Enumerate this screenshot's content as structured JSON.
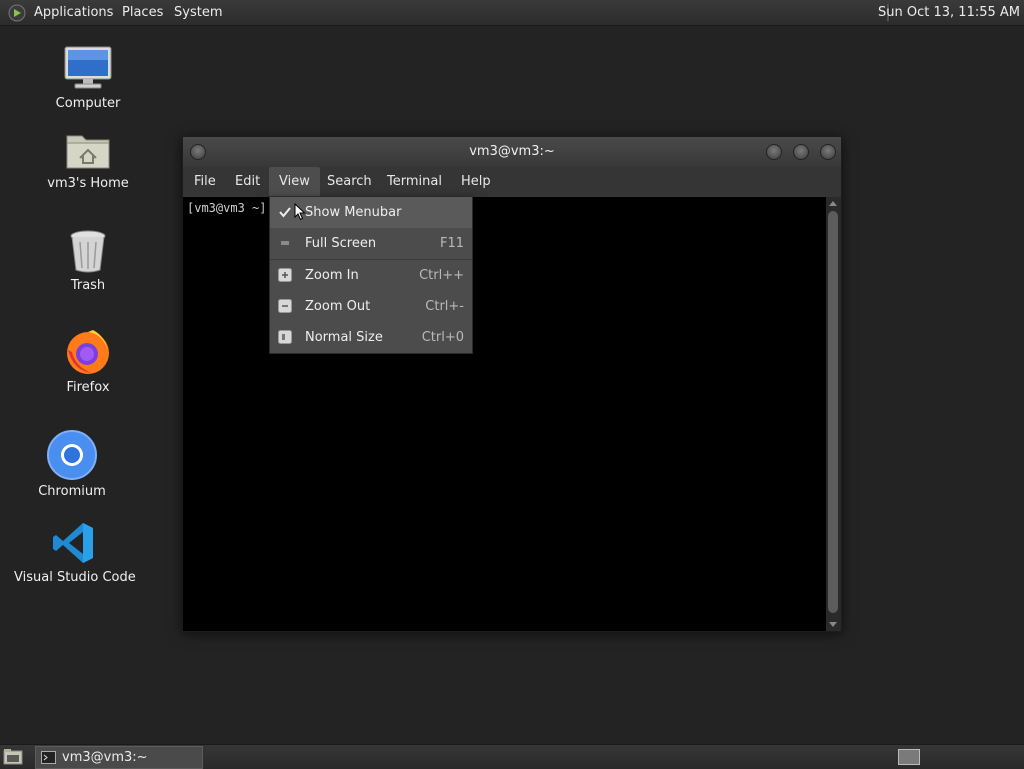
{
  "top_panel": {
    "menus": [
      "Applications",
      "Places",
      "System"
    ],
    "clock": "Sun Oct 13, 11:55 AM"
  },
  "desktop_icons": [
    {
      "label": "Computer",
      "icon": "computer-icon"
    },
    {
      "label": "vm3's Home",
      "icon": "home-folder-icon"
    },
    {
      "label": "Trash",
      "icon": "trash-icon"
    },
    {
      "label": "Firefox",
      "icon": "firefox-icon"
    },
    {
      "label": "Chromium",
      "icon": "chromium-icon"
    },
    {
      "label": "Visual Studio Code",
      "icon": "vscode-icon"
    }
  ],
  "window": {
    "title": "vm3@vm3:~",
    "menus": [
      "File",
      "Edit",
      "View",
      "Search",
      "Terminal",
      "Help"
    ],
    "active_menu": "View",
    "prompt": "[vm3@vm3 ~]"
  },
  "view_menu": {
    "items": [
      {
        "label": "Show Menubar",
        "accel": "",
        "checked": true
      },
      {
        "label": "Full Screen",
        "accel": "F11"
      },
      {
        "label": "Zoom In",
        "accel": "Ctrl++"
      },
      {
        "label": "Zoom Out",
        "accel": "Ctrl+-"
      },
      {
        "label": "Normal Size",
        "accel": "Ctrl+0"
      }
    ]
  },
  "taskbar": {
    "task_label": "vm3@vm3:~"
  },
  "colors": {
    "desktop": "#232323",
    "panel": "#2c2c2c",
    "terminal_bg": "#000000",
    "vscode_blue": "#1f8ad2",
    "chromium_blue": "#4a8ef0"
  }
}
